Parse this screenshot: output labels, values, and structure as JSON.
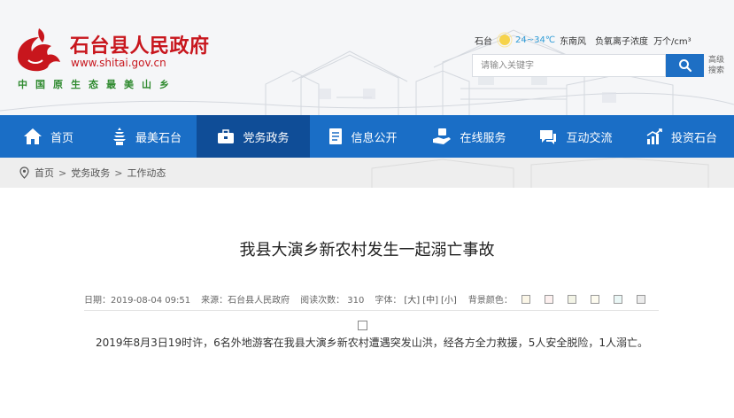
{
  "site": {
    "title": "石台县人民政府",
    "url": "www.shitai.gov.cn",
    "slogan": "中国原生态最美山乡"
  },
  "weather": {
    "city": "石台",
    "icon": "sun-icon",
    "temp": "24~34℃",
    "wind": "东南风",
    "ion_label": "负氧离子浓度",
    "ion_value": "万个/cm³"
  },
  "search": {
    "placeholder": "请输入关键字",
    "advanced_label": "高级搜索"
  },
  "nav": [
    {
      "label": "首页",
      "icon": "home-icon"
    },
    {
      "label": "最美石台",
      "icon": "pagoda-icon"
    },
    {
      "label": "党务政务",
      "icon": "briefcase-icon",
      "active": true
    },
    {
      "label": "信息公开",
      "icon": "document-icon"
    },
    {
      "label": "在线服务",
      "icon": "service-icon"
    },
    {
      "label": "互动交流",
      "icon": "chat-icon"
    },
    {
      "label": "投资石台",
      "icon": "growth-chart-icon"
    }
  ],
  "breadcrumb": {
    "home": "首页",
    "level1": "党务政务",
    "level2": "工作动态",
    "sep": ">"
  },
  "article": {
    "title": "我县大演乡新农村发生一起溺亡事故",
    "date": "日期：2019-08-04 09:51",
    "source": "来源：石台县人民政府",
    "views": "阅读次数：  310",
    "font_label": "字体：",
    "font_large": "[大]",
    "font_medium": "[中]",
    "font_small": "[小]",
    "bg_label": "背景颜色：",
    "bg_colors": [
      "#fbf6e7",
      "#fdf0ef",
      "#f3f4e6",
      "#fdfbef",
      "#eaf7f6",
      "#ececec"
    ],
    "paragraph": "2019年8月3日19时许，6名外地游客在我县大演乡新农村遭遇突发山洪，经各方全力救援，5人安全脱险，1人溺亡。"
  },
  "colors": {
    "brand_red": "#c8161d",
    "nav_blue": "#1a6ec6",
    "nav_active": "#0f4d97",
    "slogan_green": "#2f8a2f"
  }
}
